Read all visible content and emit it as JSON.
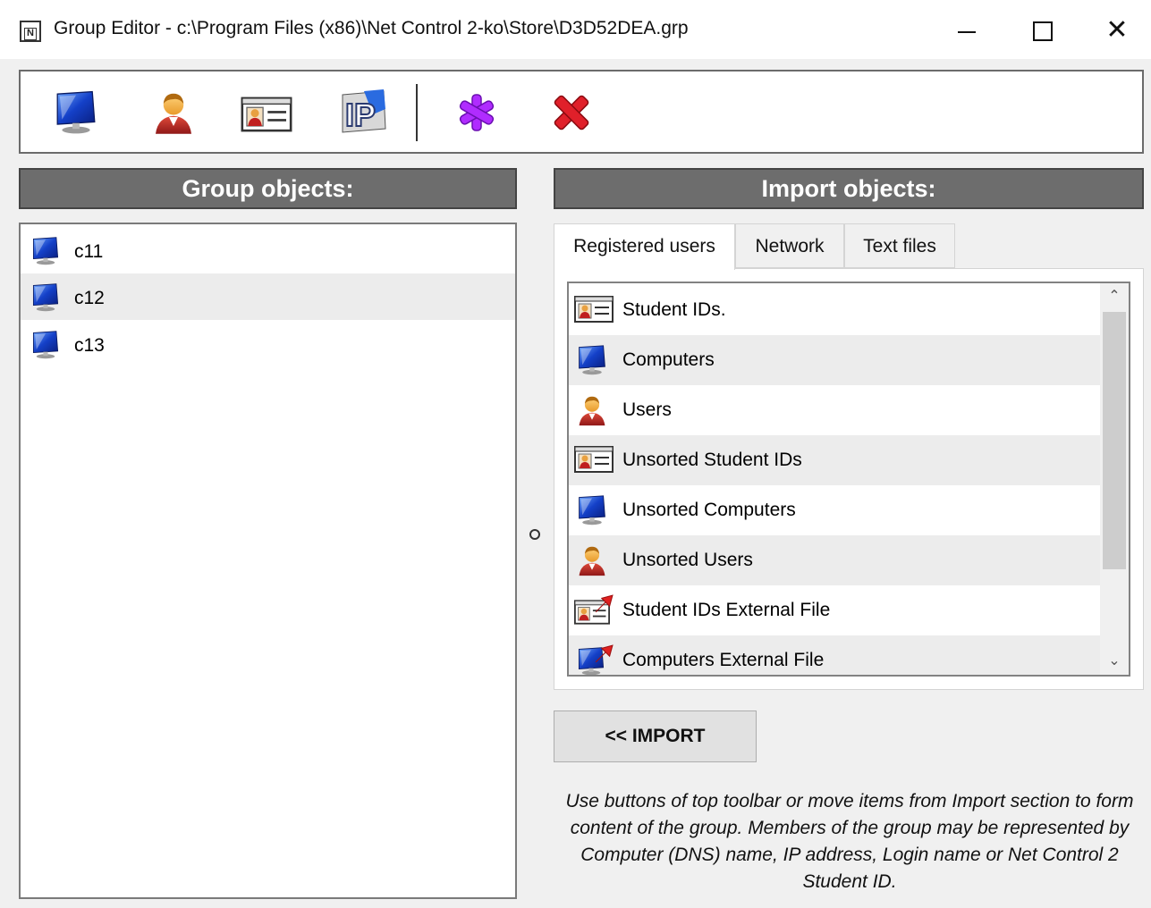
{
  "window": {
    "title": "Group Editor - c:\\Program Files (x86)\\Net Control 2-ko\\Store\\D3D52DEA.grp",
    "app_icon_letter": "N",
    "close_glyph": "✕"
  },
  "toolbar": {
    "buttons": [
      {
        "name": "add-computer-button",
        "icon": "computer-icon"
      },
      {
        "name": "add-user-button",
        "icon": "user-icon"
      },
      {
        "name": "add-student-id-button",
        "icon": "student-id-card-icon"
      },
      {
        "name": "add-ip-button",
        "icon": "ip-icon"
      },
      {
        "name": "add-any-button",
        "icon": "asterisk-icon"
      },
      {
        "name": "delete-button",
        "icon": "delete-x-icon"
      }
    ],
    "ip_label": "IP"
  },
  "group_objects": {
    "header": "Group objects:",
    "items": [
      {
        "label": "c11",
        "icon": "computer-icon"
      },
      {
        "label": "c12",
        "icon": "computer-icon",
        "selected": true
      },
      {
        "label": "c13",
        "icon": "computer-icon"
      }
    ]
  },
  "import_objects": {
    "header": "Import objects:",
    "tabs": [
      "Registered users",
      "Network",
      "Text files"
    ],
    "active_tab": "Registered users",
    "items": [
      {
        "label": "Student IDs.",
        "icon": "student-id-card-icon"
      },
      {
        "label": "Computers",
        "icon": "computer-icon"
      },
      {
        "label": "Users",
        "icon": "user-icon"
      },
      {
        "label": "Unsorted Student IDs",
        "icon": "student-id-card-icon"
      },
      {
        "label": "Unsorted Computers",
        "icon": "computer-icon"
      },
      {
        "label": "Unsorted Users",
        "icon": "user-icon"
      },
      {
        "label": "Student IDs External File",
        "icon": "student-id-external-icon"
      },
      {
        "label": "Computers External File",
        "icon": "computer-external-icon"
      }
    ],
    "scroll_up": "⌃",
    "scroll_down": "⌄"
  },
  "import_button": "<< IMPORT",
  "hint": "Use buttons of top toolbar or move items from Import section to form content of the group. Members of the group may be represented by Computer (DNS) name, IP address, Login name or Net Control 2 Student ID.",
  "colors": {
    "header_bg": "#6d6d6d",
    "asterisk": "#b02cff",
    "delete": "#e0202a",
    "computer_blue": "#1440c8"
  }
}
